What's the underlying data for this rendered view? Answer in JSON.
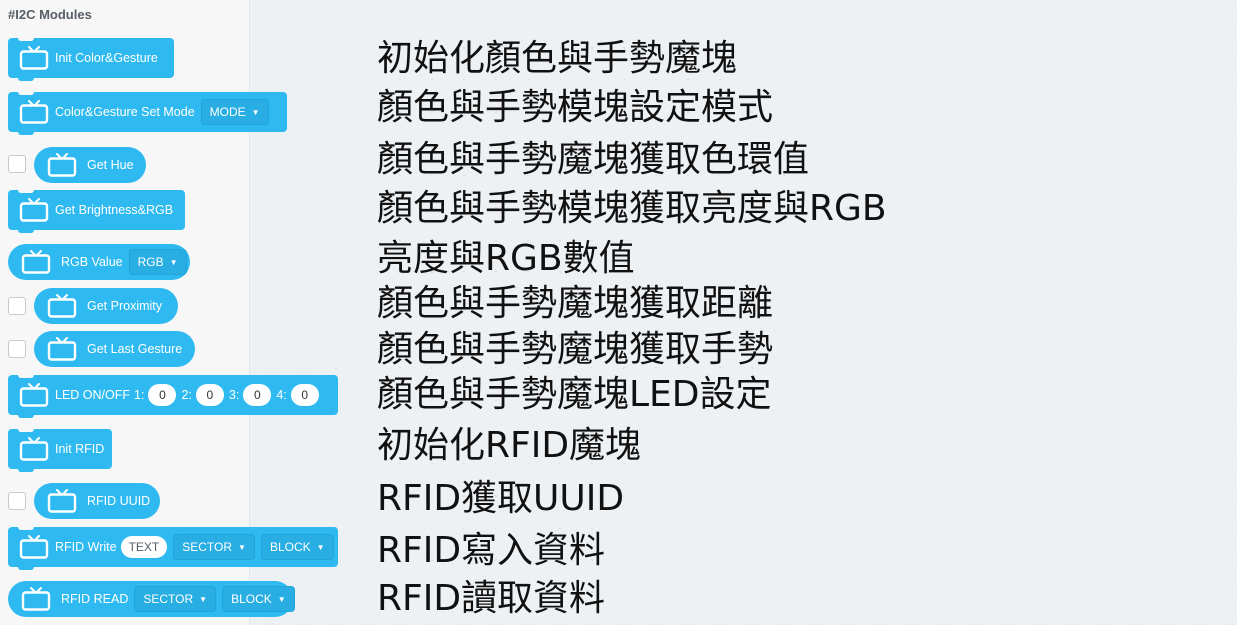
{
  "palette": {
    "title": "#I2C Modules",
    "blocks": [
      {
        "label": "Init Color&Gesture",
        "icon": "monitor-icon"
      },
      {
        "label": "Color&Gesture Set Mode",
        "dropdown": "MODE",
        "icon": "monitor-icon"
      },
      {
        "label": "Get Hue",
        "icon": "monitor-icon"
      },
      {
        "label": "Get Brightness&RGB",
        "icon": "monitor-icon"
      },
      {
        "label": "RGB Value",
        "dropdown": "RGB",
        "icon": "monitor-icon"
      },
      {
        "label": "Get Proximity",
        "icon": "monitor-icon"
      },
      {
        "label": "Get Last Gesture",
        "icon": "monitor-icon"
      },
      {
        "label": "LED ON/OFF",
        "fields": [
          {
            "label": "1:",
            "value": "0"
          },
          {
            "label": "2:",
            "value": "0"
          },
          {
            "label": "3:",
            "value": "0"
          },
          {
            "label": "4:",
            "value": "0"
          }
        ],
        "icon": "monitor-icon"
      },
      {
        "label": "Init RFID",
        "icon": "monitor-icon"
      },
      {
        "label": "RFID UUID",
        "icon": "monitor-icon"
      },
      {
        "label": "RFID Write",
        "text_input": "TEXT",
        "dropdowns": [
          "SECTOR",
          "BLOCK"
        ],
        "icon": "monitor-icon"
      },
      {
        "label": "RFID READ",
        "dropdowns": [
          "SECTOR",
          "BLOCK"
        ],
        "icon": "monitor-icon"
      }
    ]
  },
  "captions": [
    "初始化顏色與手勢魔塊",
    "顏色與手勢模塊設定模式",
    "顏色與手勢魔塊獲取色環值",
    "顏色與手勢模塊獲取亮度與RGB",
    "亮度與RGB數值",
    "顏色與手勢魔塊獲取距離",
    "顏色與手勢魔塊獲取手勢",
    "顏色與手勢魔塊LED設定",
    "初始化RFID魔塊",
    "RFID獲取UUID",
    "RFID寫入資料",
    "RFID讀取資料"
  ],
  "colors": {
    "block": "#2ebaf0",
    "palette_bg": "#f7f7f7",
    "workspace_bg": "#eef1f4"
  }
}
